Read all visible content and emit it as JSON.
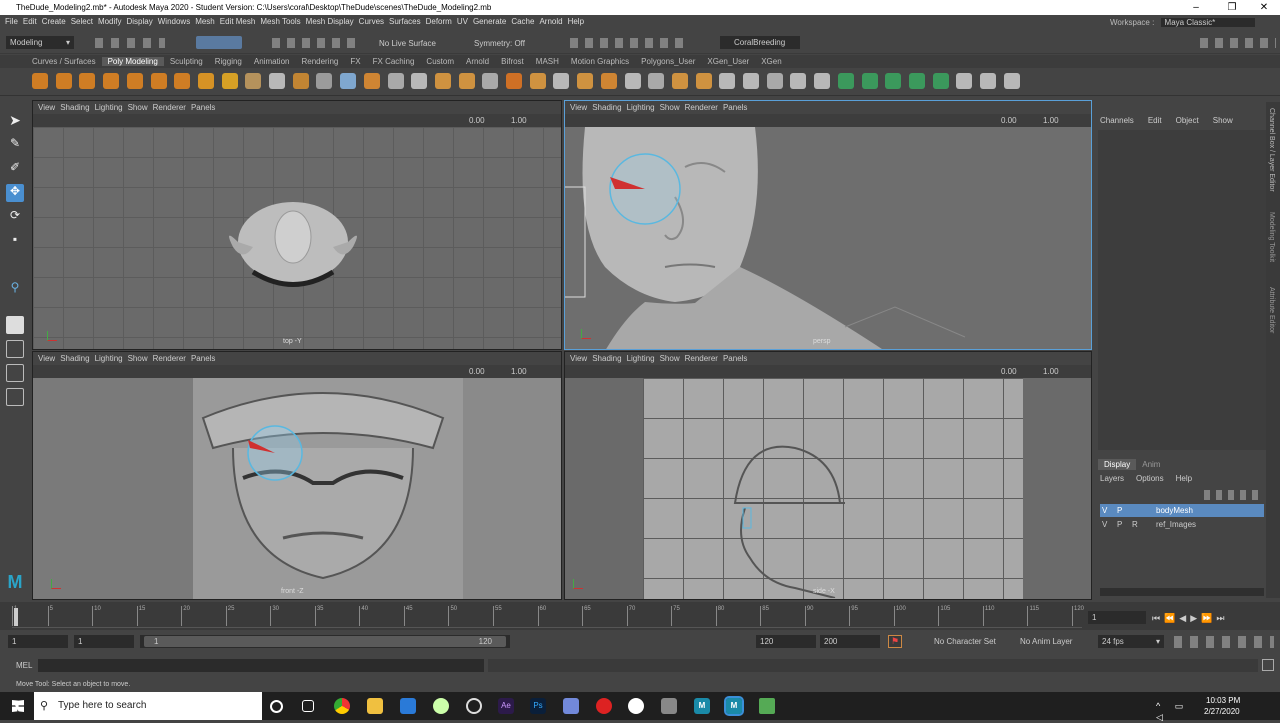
{
  "title": "TheDude_Modeling2.mb* - Autodesk Maya 2020 - Student Version: C:\\Users\\coral\\Desktop\\TheDude\\scenes\\TheDude_Modeling2.mb",
  "menus": [
    "File",
    "Edit",
    "Create",
    "Select",
    "Modify",
    "Display",
    "Windows",
    "Mesh",
    "Edit Mesh",
    "Mesh Tools",
    "Mesh Display",
    "Curves",
    "Surfaces",
    "Deform",
    "UV",
    "Generate",
    "Cache",
    "Arnold",
    "Help"
  ],
  "workspace": {
    "label": "Workspace :",
    "value": "Maya Classic*"
  },
  "status": {
    "mode": "Modeling",
    "live_surface": "No Live Surface",
    "symmetry": "Symmetry: Off",
    "user": "CoralBreeding"
  },
  "shelf_tabs": [
    "Curves / Surfaces",
    "Poly Modeling",
    "Sculpting",
    "Rigging",
    "Animation",
    "Rendering",
    "FX",
    "FX Caching",
    "Custom",
    "Arnold",
    "Bifrost",
    "MASH",
    "Motion Graphics",
    "Polygons_User",
    "XGen_User",
    "XGen"
  ],
  "active_shelf": "Poly Modeling",
  "viewport_menu": [
    "View",
    "Shading",
    "Lighting",
    "Show",
    "Renderer",
    "Panels"
  ],
  "viewport_values": {
    "exposure": "0.00",
    "gamma": "1.00"
  },
  "viewports": {
    "top": {
      "label": "top -Y"
    },
    "persp": {
      "label": "persp"
    },
    "front": {
      "label": "front -Z"
    },
    "side": {
      "label": "side -X"
    }
  },
  "channel_box": {
    "menu": [
      "Channels",
      "Edit",
      "Object",
      "Show"
    ]
  },
  "layer_editor": {
    "tabs": [
      "Display",
      "Anim"
    ],
    "menu": [
      "Layers",
      "Options",
      "Help"
    ],
    "layers": [
      {
        "v": "V",
        "p": "P",
        "r": "",
        "name": "bodyMesh",
        "selected": true
      },
      {
        "v": "V",
        "p": "P",
        "r": "R",
        "name": "ref_Images",
        "selected": false
      }
    ]
  },
  "timeline": {
    "ticks": [
      "1",
      "5",
      "10",
      "15",
      "20",
      "25",
      "30",
      "35",
      "40",
      "45",
      "50",
      "55",
      "60",
      "65",
      "70",
      "75",
      "80",
      "85",
      "90",
      "95",
      "100",
      "105",
      "110",
      "115",
      "120"
    ],
    "current": "1"
  },
  "range": {
    "start": "1",
    "start2": "1",
    "slider_start": "1",
    "slider_end": "120",
    "end": "120",
    "end2": "200",
    "character_set": "No Character Set",
    "anim_layer": "No Anim Layer",
    "fps": "24 fps"
  },
  "cmd": {
    "label": "MEL"
  },
  "help": "Move Tool: Select an object to move.",
  "taskbar": {
    "search": "Type here to search",
    "time": "10:03 PM",
    "date": "2/27/2020"
  },
  "side_labels": [
    "Channel Box / Layer Editor",
    "Modeling Toolkit",
    "Attribute Editor"
  ]
}
